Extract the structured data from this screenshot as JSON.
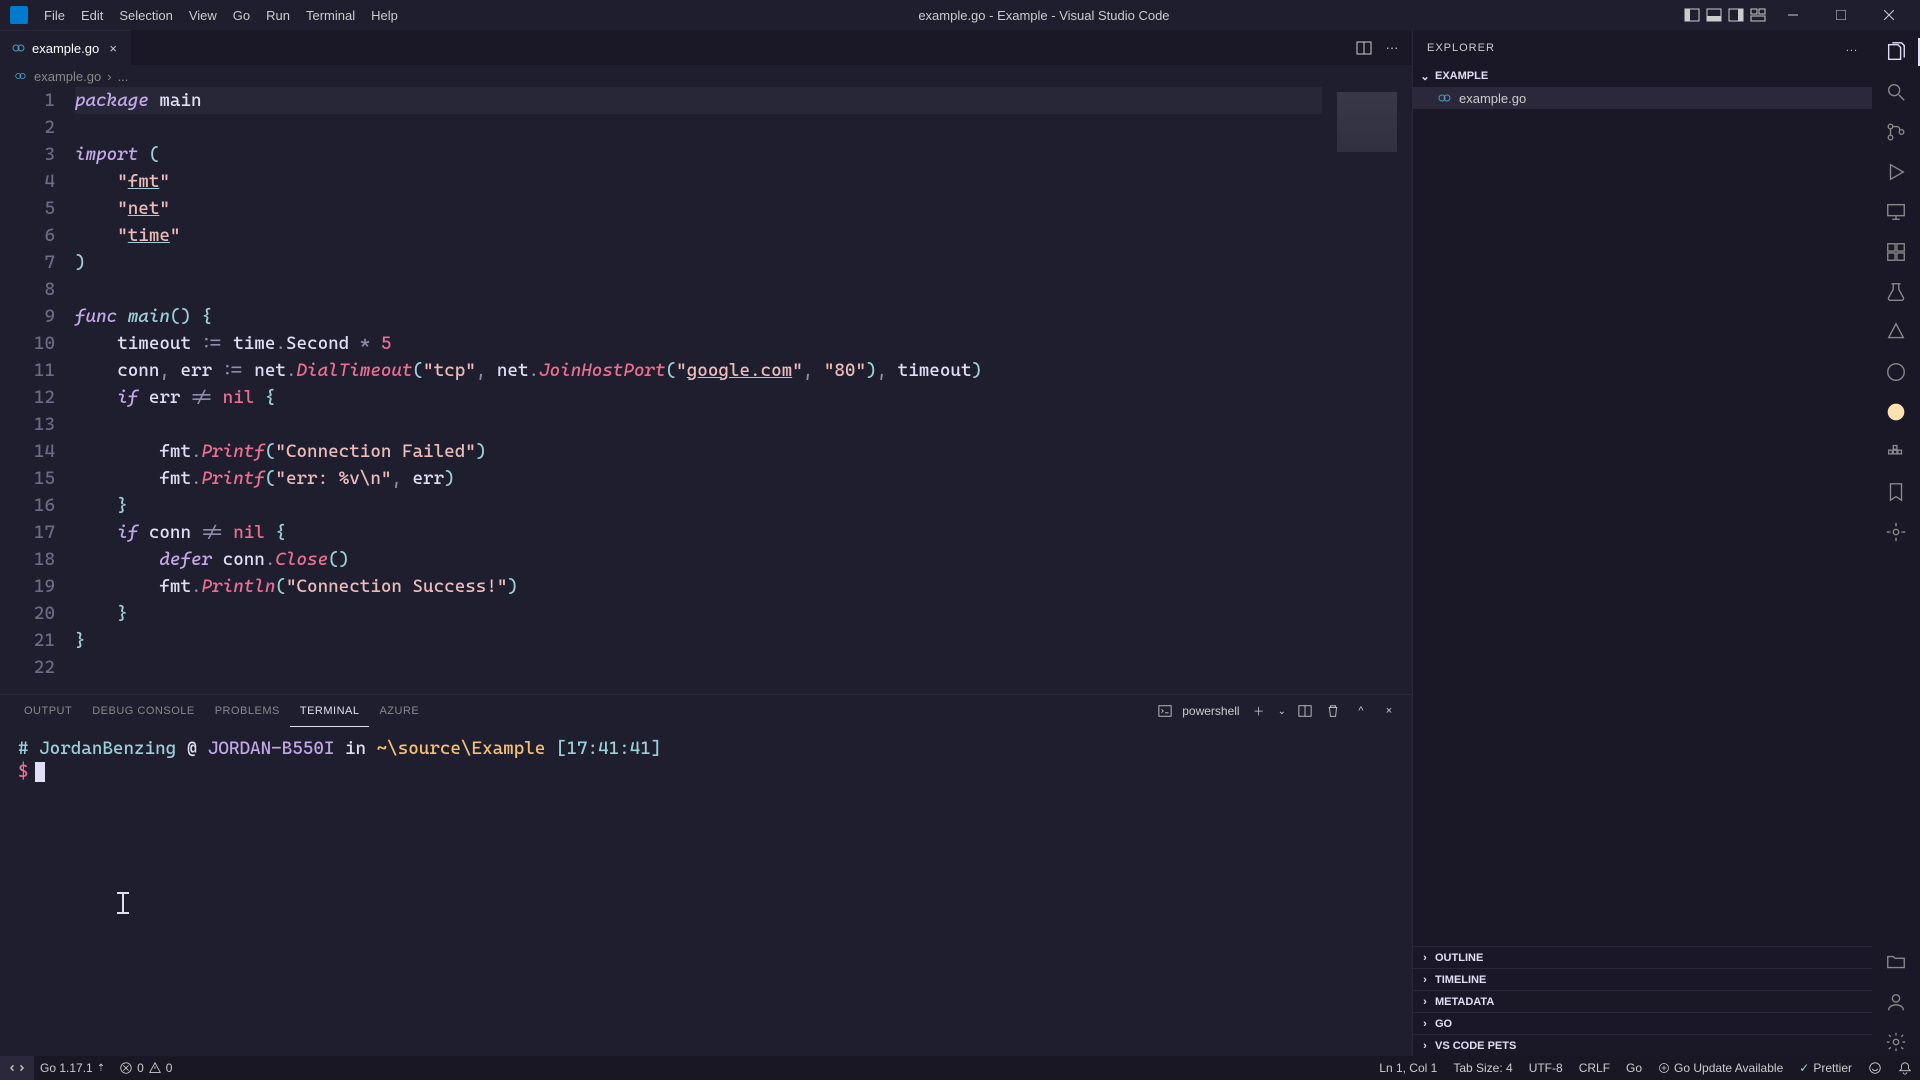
{
  "titlebar": {
    "menu": [
      "File",
      "Edit",
      "Selection",
      "View",
      "Go",
      "Run",
      "Terminal",
      "Help"
    ],
    "title": "example.go - Example - Visual Studio Code"
  },
  "tab": {
    "label": "example.go"
  },
  "breadcrumb": {
    "file": "example.go",
    "sep": "›",
    "dots": "..."
  },
  "code": {
    "line_count": 22
  },
  "panel": {
    "tabs": [
      "OUTPUT",
      "DEBUG CONSOLE",
      "PROBLEMS",
      "TERMINAL",
      "AZURE"
    ],
    "active_tab": "TERMINAL",
    "shell_label": "powershell"
  },
  "terminal": {
    "hash": "#",
    "user": "JordanBenzing",
    "at": "@",
    "host": "JORDAN-B550I",
    "in_word": "in",
    "path": "~\\source\\Example",
    "time": "[17:41:41]",
    "dollar": "$"
  },
  "sidebar": {
    "title": "EXPLORER",
    "more": "...",
    "project": "EXAMPLE",
    "file": "example.go",
    "sections": [
      "OUTLINE",
      "TIMELINE",
      "METADATA",
      "GO",
      "VS CODE PETS"
    ]
  },
  "statusbar": {
    "go_version": "Go 1.17.1",
    "errors": "0",
    "warnings": "0",
    "cursor": "Ln 1, Col 1",
    "tab_size": "Tab Size: 4",
    "encoding": "UTF-8",
    "eol": "CRLF",
    "lang": "Go",
    "update": "Go Update Available",
    "prettier": "Prettier"
  }
}
